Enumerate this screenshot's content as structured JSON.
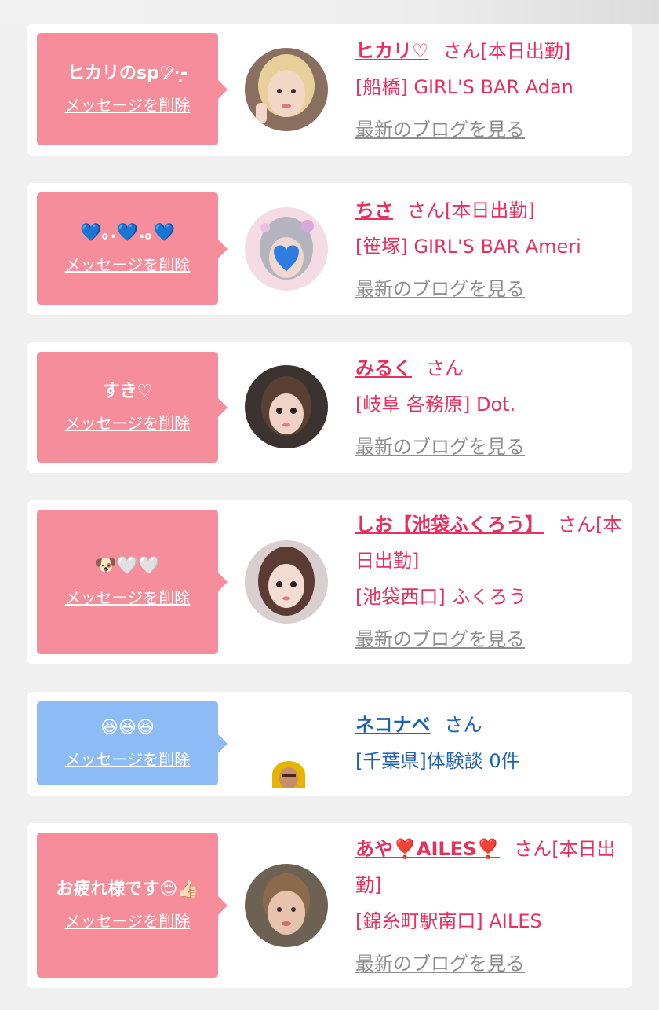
{
  "delete_label": "メッセージを削除",
  "blog_label": "最新のブログを見る",
  "san": "さん",
  "cards": [
    {
      "message": "ヒカリのsp♡̷̷·̩͙-",
      "name": "ヒカリ♡",
      "status": "[本日出勤]",
      "shop": "[船橋] GIRL'S BAR Adan",
      "color": "pink"
    },
    {
      "message": "💙｡.💙.｡💙",
      "name": "ちさ",
      "status": "[本日出勤]",
      "shop": "[笹塚] GIRL'S BAR Ameri",
      "color": "pink"
    },
    {
      "message": "すき♡",
      "name": "みるく",
      "status": "",
      "shop": "[岐阜 各務原] Dot.",
      "color": "pink"
    },
    {
      "message": "🐶🤍🤍",
      "name": "しお【池袋ふくろう】",
      "status": "[本日出勤]",
      "shop": "[池袋西口] ふくろう",
      "color": "pink"
    },
    {
      "message": "😆😆😆",
      "name": "ネコナベ",
      "status": "",
      "shop": "[千葉県]体験談 0件",
      "color": "blue"
    },
    {
      "message": "お疲れ様です😌👍🏻",
      "name": "あや❣️AILES❣️",
      "status": "[本日出勤]",
      "shop": "[錦糸町駅南口] AILES",
      "color": "pink"
    }
  ],
  "colors": {
    "pink_bubble": "#f58d9b",
    "blue_bubble": "#8cbbf5",
    "name_pink": "#e8305f",
    "name_blue": "#1d63b3",
    "blog_gray": "#8d8d8d"
  }
}
